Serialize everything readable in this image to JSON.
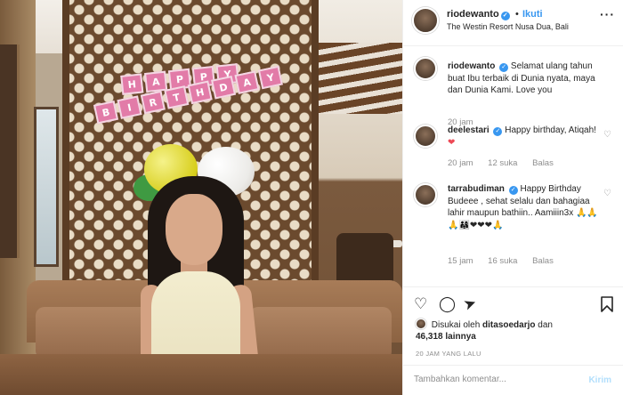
{
  "post": {
    "username": "riodewanto",
    "follow_label": "Ikuti",
    "separator": "•",
    "location": "The Westin Resort Nusa Dua, Bali",
    "more_icon": "ellipsis-icon"
  },
  "photo": {
    "banner_row1": [
      "H",
      "A",
      "P",
      "P",
      "Y"
    ],
    "banner_row2": [
      "B",
      "I",
      "R",
      "T",
      "H",
      "D",
      "A",
      "Y"
    ]
  },
  "comments": [
    {
      "username": "riodewanto",
      "text": "Selamat ulang tahun buat Ibu terbaik di Dunia nyata, maya dan Dunia Kami. Love you",
      "time": "20 jam"
    },
    {
      "username": "deelestari",
      "text": "Happy birthday, Atiqah!",
      "emoji": "❤",
      "time": "20 jam",
      "likes": "12 suka",
      "reply_label": "Balas"
    },
    {
      "username": "tarrabudiman",
      "text": "Happy Birthday Budeee , sehat selalu dan bahagiaa lahir maupun bathiin.. Aamiiin3x",
      "emoji": "🙏🙏🙏👨‍👩‍👧❤❤❤🙏",
      "time": "15 jam",
      "likes": "16 suka",
      "reply_label": "Balas"
    }
  ],
  "actions": {
    "like_icon": "heart-icon",
    "comment_icon": "comment-icon",
    "share_icon": "share-icon",
    "save_icon": "bookmark-icon"
  },
  "likes_line": {
    "prefix": "Disukai oleh",
    "user": "ditasoedarjo",
    "conj": "dan",
    "count": "46,318",
    "suffix": "lainnya"
  },
  "time_ago": "20 JAM YANG LALU",
  "add_comment": {
    "placeholder": "Tambahkan komentar...",
    "post_label": "Kirim"
  },
  "colors": {
    "accent": "#3897f0",
    "heart": "#ed4956",
    "muted": "#8e8e8e"
  }
}
